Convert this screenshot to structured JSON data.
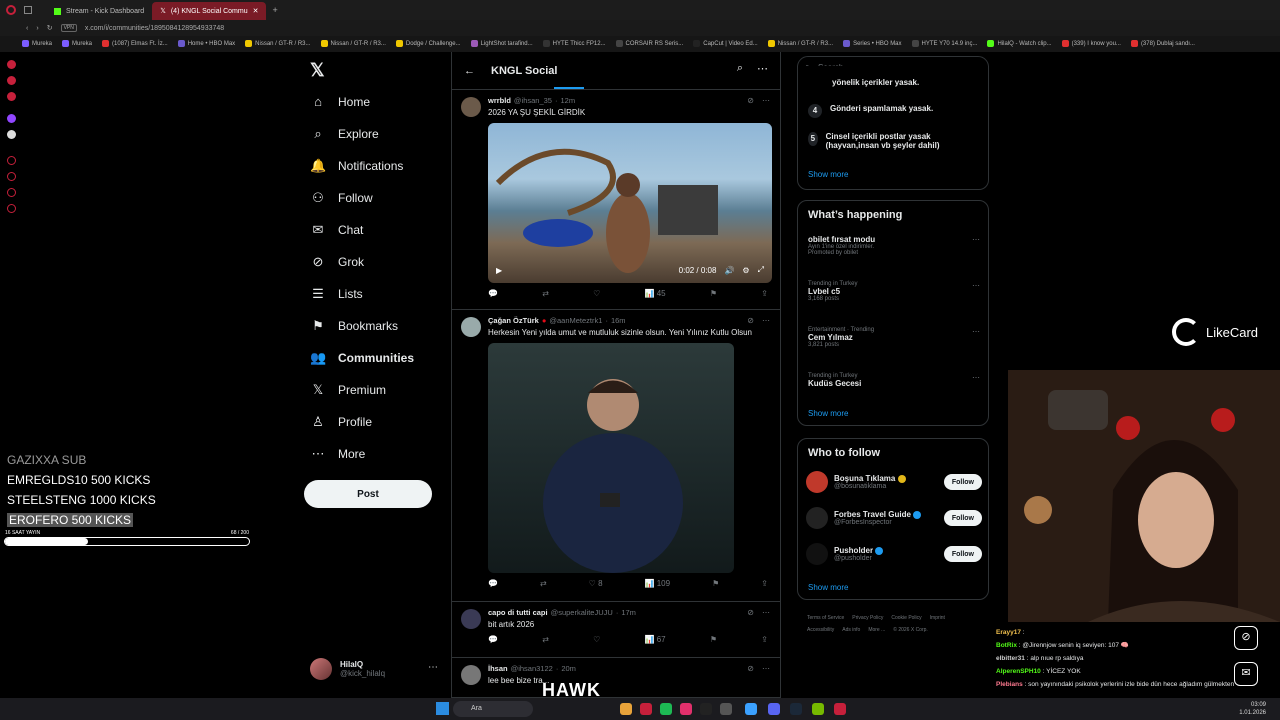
{
  "browser": {
    "tabs": [
      {
        "label": "Stream - Kick Dashboard",
        "active": false
      },
      {
        "label": "(4) KNGL Social Commu",
        "active": true
      }
    ],
    "url": "x.com/i/communities/1895084128954933748",
    "bookmarks": [
      "Mureka",
      "Mureka",
      "(1087) Elmas Ft. İz...",
      "Home • HBO Max",
      "Nissan / GT-R / R3...",
      "Nissan / GT-R / R3...",
      "Dodge / Challenge...",
      "LightShot tarafind...",
      "HYTE Thicc FP12...",
      "CORSAIR RS Seris...",
      "CapCut | Video Ed...",
      "Nissan / GT-R / R3...",
      "Series • HBO Max",
      "HYTE Y70 14.9 inç...",
      "HilalQ - Watch clip...",
      "(339) I know you...",
      "(378) Dublaj sandı..."
    ]
  },
  "nav": {
    "items": [
      {
        "label": "Home",
        "icon": "home-icon",
        "glyph": "⌂"
      },
      {
        "label": "Explore",
        "icon": "search-icon",
        "glyph": "⌕"
      },
      {
        "label": "Notifications",
        "icon": "bell-icon",
        "glyph": "🔔"
      },
      {
        "label": "Follow",
        "icon": "add-user-icon",
        "glyph": "⚇"
      },
      {
        "label": "Chat",
        "icon": "envelope-icon",
        "glyph": "✉"
      },
      {
        "label": "Grok",
        "icon": "grok-icon",
        "glyph": "⊘"
      },
      {
        "label": "Lists",
        "icon": "list-icon",
        "glyph": "☰"
      },
      {
        "label": "Bookmarks",
        "icon": "bookmark-icon",
        "glyph": "⚑"
      },
      {
        "label": "Communities",
        "icon": "communities-icon",
        "glyph": "👥"
      },
      {
        "label": "Premium",
        "icon": "x-premium-icon",
        "glyph": "𝕏"
      },
      {
        "label": "Profile",
        "icon": "profile-icon",
        "glyph": "♙"
      },
      {
        "label": "More",
        "icon": "more-icon",
        "glyph": "⋯"
      }
    ],
    "post_label": "Post",
    "profile": {
      "name": "HilalQ",
      "handle": "@kick_hilalq"
    }
  },
  "feed": {
    "title": "KNGL Social",
    "tweets": [
      {
        "name": "wrrbld",
        "handle": "@ihsan_35",
        "time": "12m",
        "text": "2026 YA ŞU ŞEKİL GİRDİK",
        "video_time": "0:02 / 0:08",
        "views": "45",
        "likes": ""
      },
      {
        "name": "Çağan ÖzTürk",
        "handle": "@aanMeteztrk1",
        "time": "16m",
        "text": "Herkesin Yeni yılda umut ve mutluluk sizinle olsun. Yeni Yılınız Kutlu Olsun",
        "views": "109",
        "likes": "8"
      },
      {
        "name": "capo di tutti capi",
        "handle": "@superkaliteJUJU",
        "time": "17m",
        "text": "bit artık 2026",
        "views": "67",
        "likes": ""
      },
      {
        "name": "İhsan",
        "handle": "@ihsan3122",
        "time": "20m",
        "text": "lee bee bize tra...",
        "views": "",
        "likes": ""
      }
    ]
  },
  "sidebar": {
    "search_placeholder": "Search",
    "rules_partial": "yönelik içerikler yasak.",
    "rules": [
      {
        "num": "4",
        "text": "Gönderi spamlamak yasak."
      },
      {
        "num": "5",
        "text": "Cinsel içerikli postlar yasak (hayvan,insan vb şeyler dahil)"
      }
    ],
    "show_more": "Show more",
    "happening_title": "What’s happening",
    "trends": [
      {
        "context": "Ayın 1'ine özel indirimler.",
        "title": "obilet fırsat modu",
        "count": "Promoted by obilet",
        "promoted": true
      },
      {
        "context": "Trending in Turkey",
        "title": "Lvbel c5",
        "count": "3,168 posts"
      },
      {
        "context": "Entertainment · Trending",
        "title": "Cem Yılmaz",
        "count": "3,821 posts"
      },
      {
        "context": "Trending in Turkey",
        "title": "Kudüs Gecesi",
        "count": ""
      }
    ],
    "who_title": "Who to follow",
    "who": [
      {
        "name": "Boşuna Tıklama",
        "handle": "@bosunatiklama",
        "follow": "Follow",
        "badge": "gold",
        "color": "#c0392b"
      },
      {
        "name": "Forbes Travel Guide",
        "handle": "@ForbesInspector",
        "follow": "Follow",
        "badge": "blue",
        "color": "#222"
      },
      {
        "name": "Pusholder",
        "handle": "@pusholder",
        "follow": "Follow",
        "badge": "blue",
        "color": "#111"
      }
    ],
    "footer": [
      "Terms of Service",
      "Privacy Policy",
      "Cookie Policy",
      "Imprint",
      "Accessibility",
      "Ads info",
      "More ...",
      "© 2026 X Corp."
    ]
  },
  "overlay": {
    "kicks": [
      {
        "text": "GAZIXXA  SUB",
        "style": "dim"
      },
      {
        "text": "EMREGLDS10  500 KICKS",
        "style": "normal"
      },
      {
        "text": "STEELSTENG  1000 KICKS",
        "style": "normal"
      },
      {
        "text": "EROFERO  500 KICKS",
        "style": "hl"
      }
    ],
    "bar_label": "16 SAAT YAYIN",
    "bar_count": "68  / 200",
    "bar_fraction": 0.34,
    "sponsor": "LikeCard",
    "brand": "HAWK"
  },
  "chat": [
    {
      "user": "Erayy17",
      "msg": "",
      "cls": "u1"
    },
    {
      "user": "BotRix",
      "msg": "@Jirennjow senin iq seviyen: 107 🧠",
      "cls": "u2"
    },
    {
      "user": "elbitter31",
      "msg": "alp nıue rp saldıya",
      "cls": "u3"
    },
    {
      "user": "AlperenSPH10",
      "msg": "YİCEZ YOK",
      "cls": "u2"
    },
    {
      "user": "Plebians",
      "msg": "son yayınındaki psikolok yerlerini izle bide dün hece ağladım gülmekten",
      "cls": "u4"
    }
  ],
  "taskbar": {
    "search": "Ara",
    "time": "03:09",
    "date": "1.01.2026"
  },
  "colors": {
    "accent": "#1d9bf0",
    "kick_green": "#53fc18",
    "opera_red": "#c6203b"
  }
}
